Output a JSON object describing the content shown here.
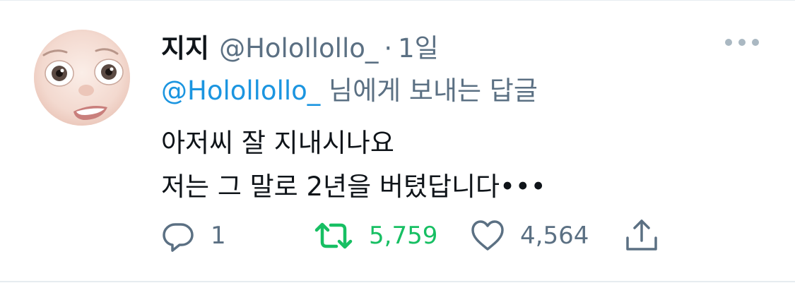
{
  "tweet": {
    "author_name": "지지",
    "handle": "@Hololl​ollo_",
    "separator": "·",
    "time_ago": "1일",
    "reply_to": {
      "mention": "@Hololl​ollo_",
      "suffix": " 님에게 보내는 답글"
    },
    "text_lines": [
      "아저씨 잘 지내시나요",
      "저는 그 말로 2년을 버텼답니다•••"
    ],
    "actions": {
      "reply_count": "1",
      "retweet_count": "5,759",
      "like_count": "4,564"
    }
  },
  "colors": {
    "text": "#0f1419",
    "secondary": "#5b7083",
    "link": "#1b95e0",
    "retweet_active": "#17bf63",
    "divider": "#e6ecf0"
  },
  "icons": {
    "more": "more-icon",
    "reply": "reply-icon",
    "retweet": "retweet-icon",
    "like": "heart-icon",
    "share": "share-icon",
    "avatar": "memoji-avatar"
  }
}
